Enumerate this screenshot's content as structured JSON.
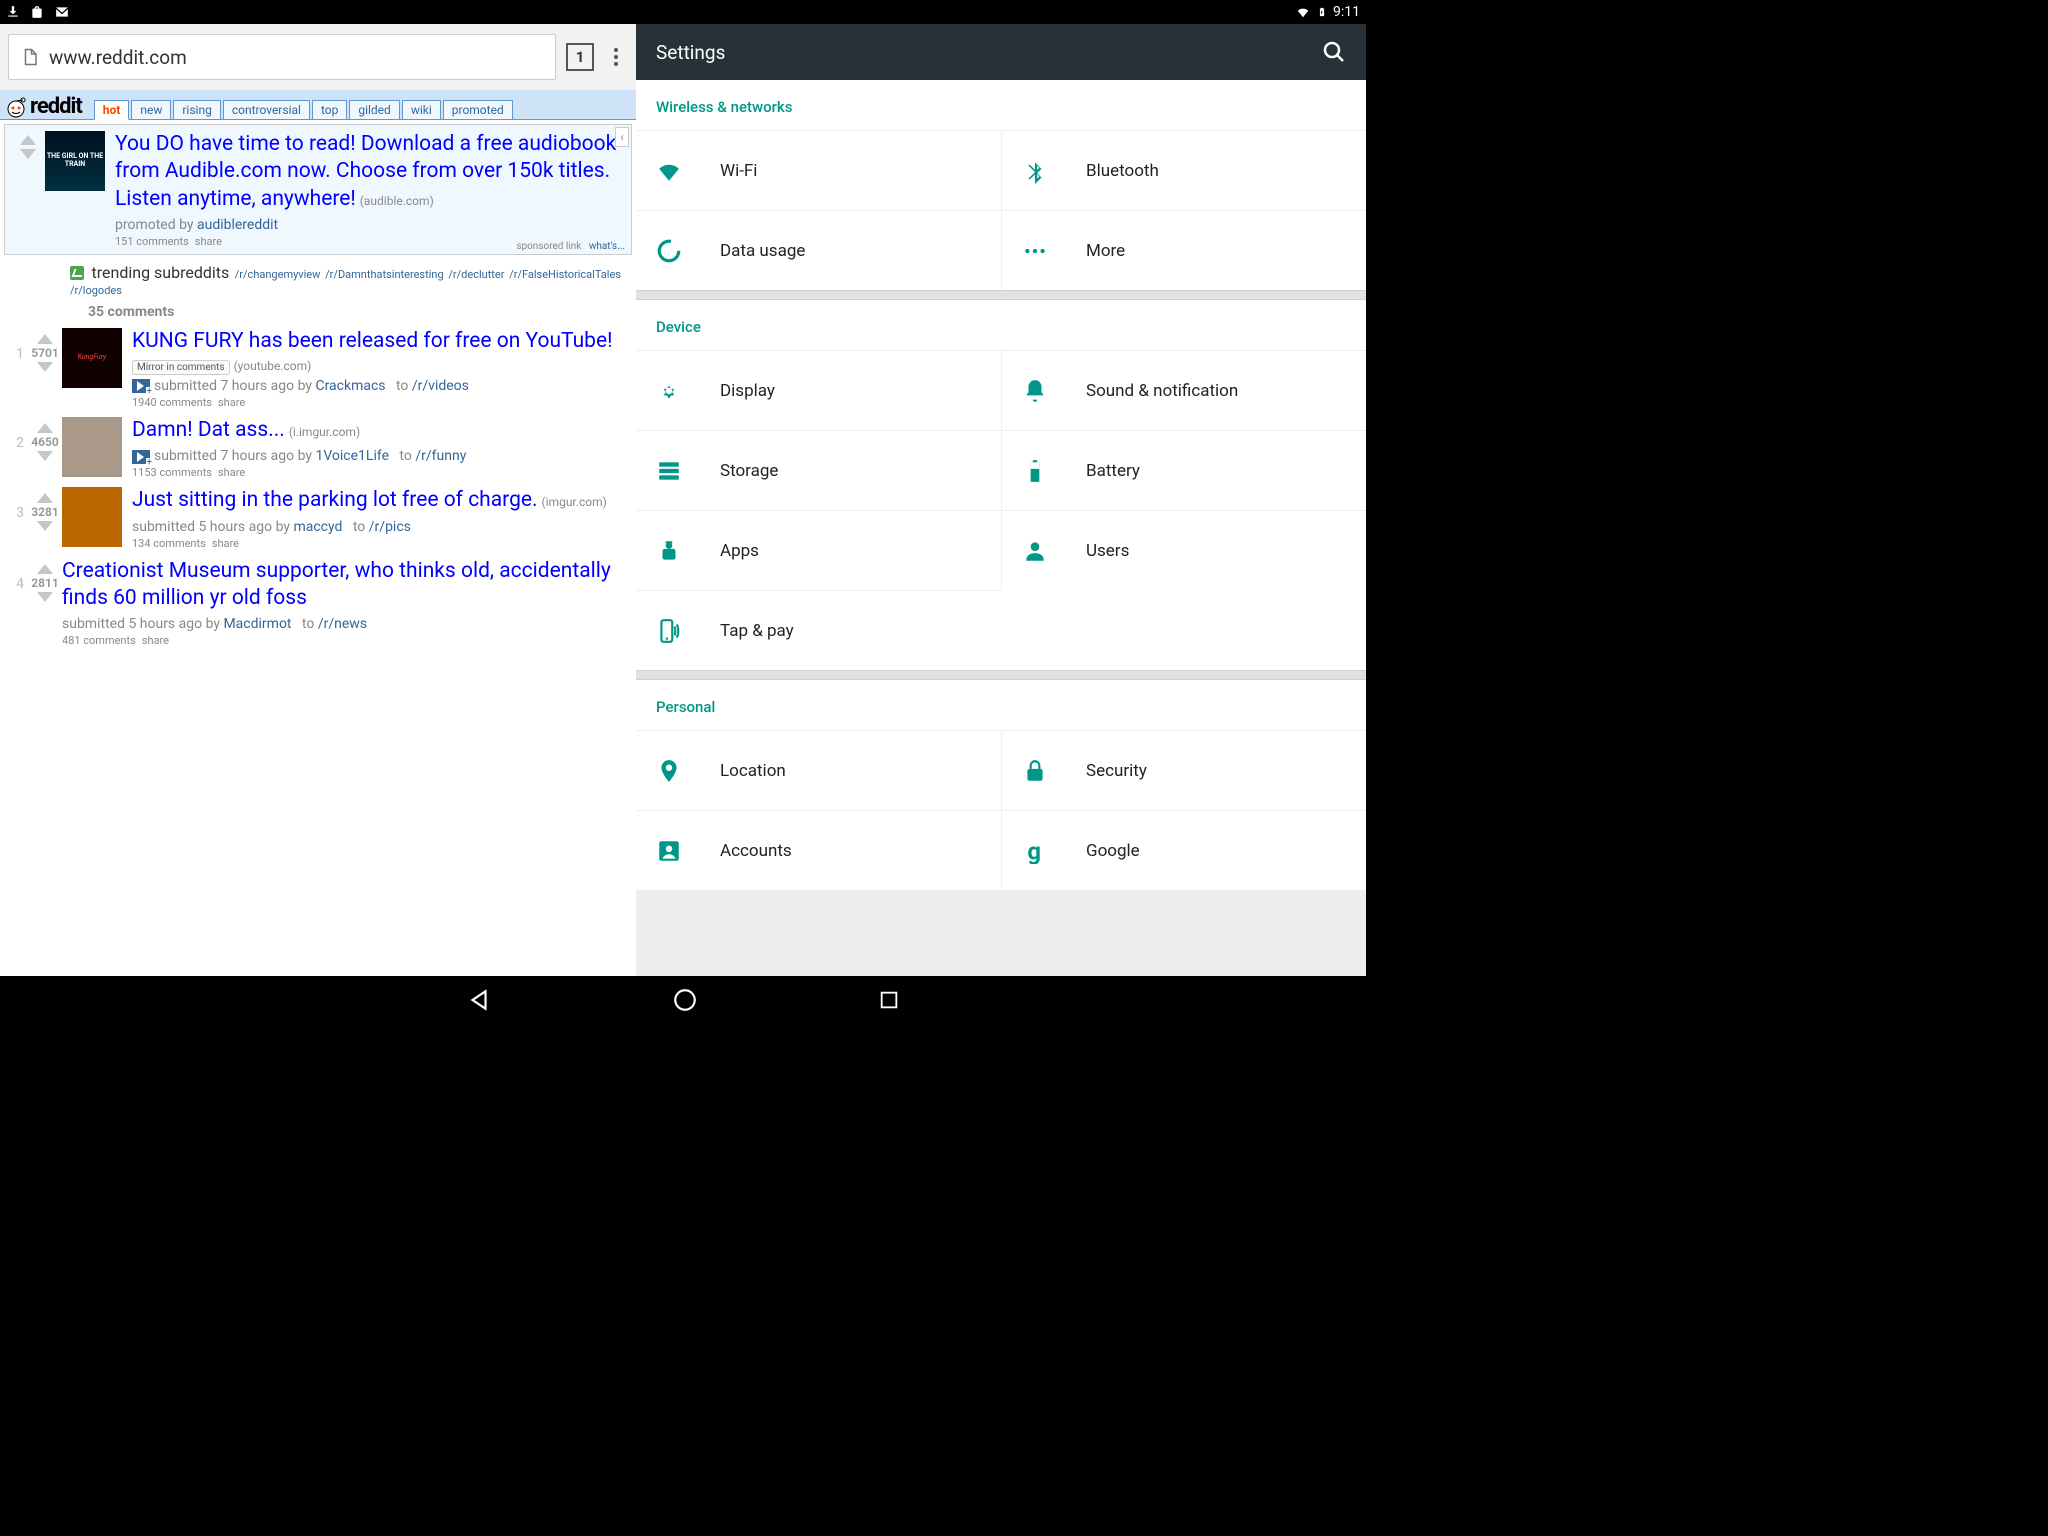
{
  "status": {
    "time": "9:11"
  },
  "browser": {
    "url": "www.reddit.com",
    "tab_count": "1"
  },
  "reddit": {
    "logo_text": "reddit",
    "tabs": [
      "hot",
      "new",
      "rising",
      "controversial",
      "top",
      "gilded",
      "wiki",
      "promoted"
    ],
    "active_tab": 0,
    "promo": {
      "title": "You DO have time to read! Download a free audiobook from Audible.com now. Choose from over 150k titles. Listen anytime, anywhere!",
      "domain": "audible.com",
      "byline_prefix": "promoted by ",
      "author": "audiblereddit",
      "comments": "151 comments",
      "share": "share",
      "sponsored": "sponsored link",
      "whats": "what's...",
      "thumb_text": "THE GIRL ON THE TRAIN"
    },
    "trending": {
      "label": "trending subreddits",
      "subs": [
        "/r/changemyview",
        "/r/Damnthatsinteresting",
        "/r/declutter",
        "/r/FalseHistoricalTales",
        "/r/logodes"
      ],
      "comments": "35 comments"
    },
    "posts": [
      {
        "rank": "1",
        "score": "5701",
        "title": "KUNG FURY has been released for free on YouTube!",
        "pill": "Mirror in comments",
        "domain": "youtube.com",
        "play": true,
        "time": "submitted 7 hours ago by ",
        "author": "Crackmacs",
        "sub": "/r/videos",
        "comments": "1940 comments",
        "share": "share",
        "thumb_bg": "#100",
        "thumb_text": "KungFury"
      },
      {
        "rank": "2",
        "score": "4650",
        "title": "Damn! Dat ass...",
        "domain": "i.imgur.com",
        "play": true,
        "time": "submitted 7 hours ago by ",
        "author": "1Voice1Life",
        "sub": "/r/funny",
        "comments": "1153 comments",
        "share": "share",
        "thumb_bg": "#a98",
        "thumb_text": ""
      },
      {
        "rank": "3",
        "score": "3281",
        "title": "Just sitting in the parking lot free of charge.",
        "domain": "imgur.com",
        "time": "submitted 5 hours ago by ",
        "author": "maccyd",
        "sub": "/r/pics",
        "comments": "134 comments",
        "share": "share",
        "thumb_bg": "#b60",
        "thumb_text": ""
      },
      {
        "rank": "4",
        "score": "2811",
        "title": "Creationist Museum supporter, who thinks old, accidentally finds 60 million yr old foss",
        "time": "submitted 5 hours ago by ",
        "author": "Macdirmot",
        "sub": "/r/news",
        "comments": "481 comments",
        "share": "share",
        "no_thumb": true
      }
    ]
  },
  "settings": {
    "title": "Settings",
    "sections": [
      {
        "header": "Wireless & networks",
        "items": [
          {
            "icon": "wifi",
            "label": "Wi-Fi"
          },
          {
            "icon": "bluetooth",
            "label": "Bluetooth"
          },
          {
            "icon": "data",
            "label": "Data usage"
          },
          {
            "icon": "more",
            "label": "More"
          }
        ]
      },
      {
        "header": "Device",
        "items": [
          {
            "icon": "display",
            "label": "Display"
          },
          {
            "icon": "bell",
            "label": "Sound & notification"
          },
          {
            "icon": "storage",
            "label": "Storage"
          },
          {
            "icon": "battery",
            "label": "Battery"
          },
          {
            "icon": "apps",
            "label": "Apps"
          },
          {
            "icon": "users",
            "label": "Users"
          },
          {
            "icon": "nfc",
            "label": "Tap & pay"
          }
        ]
      },
      {
        "header": "Personal",
        "items": [
          {
            "icon": "location",
            "label": "Location"
          },
          {
            "icon": "security",
            "label": "Security"
          },
          {
            "icon": "accounts",
            "label": "Accounts"
          },
          {
            "icon": "google",
            "label": "Google"
          }
        ]
      }
    ]
  }
}
